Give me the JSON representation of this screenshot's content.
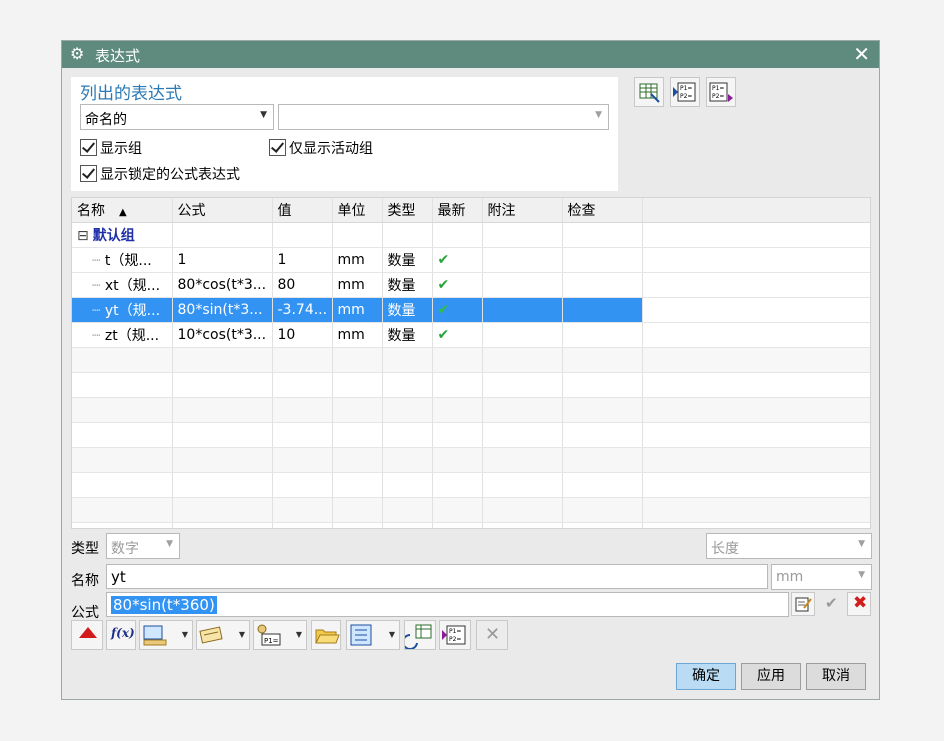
{
  "window": {
    "title": "表达式"
  },
  "listed": {
    "title": "列出的表达式",
    "filter_selected": "命名的",
    "filter_text": "",
    "checkboxes": {
      "show_groups": "显示组",
      "only_active": "仅显示活动组",
      "show_locked": "显示锁定的公式表达式"
    }
  },
  "table": {
    "headers": [
      "名称",
      "公式",
      "值",
      "单位",
      "类型",
      "最新",
      "附注",
      "检查"
    ],
    "group": "默认组",
    "rows": [
      {
        "name": "t（规...",
        "formula": "1",
        "value": "1",
        "unit": "mm",
        "type": "数量"
      },
      {
        "name": "xt（规...",
        "formula": "80*cos(t*3...",
        "value": "80",
        "unit": "mm",
        "type": "数量"
      },
      {
        "name": "yt（规...",
        "formula": "80*sin(t*3...",
        "value": "-3.74...",
        "unit": "mm",
        "type": "数量"
      },
      {
        "name": "zt（规...",
        "formula": "10*cos(t*3...",
        "value": "10",
        "unit": "mm",
        "type": "数量"
      }
    ]
  },
  "editor": {
    "type_label": "类型",
    "type_value": "数字",
    "dimension_value": "长度",
    "name_label": "名称",
    "name_value": "yt",
    "unit_value": "mm",
    "formula_label": "公式",
    "formula_value": "80*sin(t*360)"
  },
  "buttons": {
    "ok": "确定",
    "apply": "应用",
    "cancel": "取消"
  },
  "colors": {
    "titlebar": "#5e8b7e",
    "selection": "#3393f3",
    "accent_text": "#2c7ab5",
    "check": "#27a33a"
  }
}
